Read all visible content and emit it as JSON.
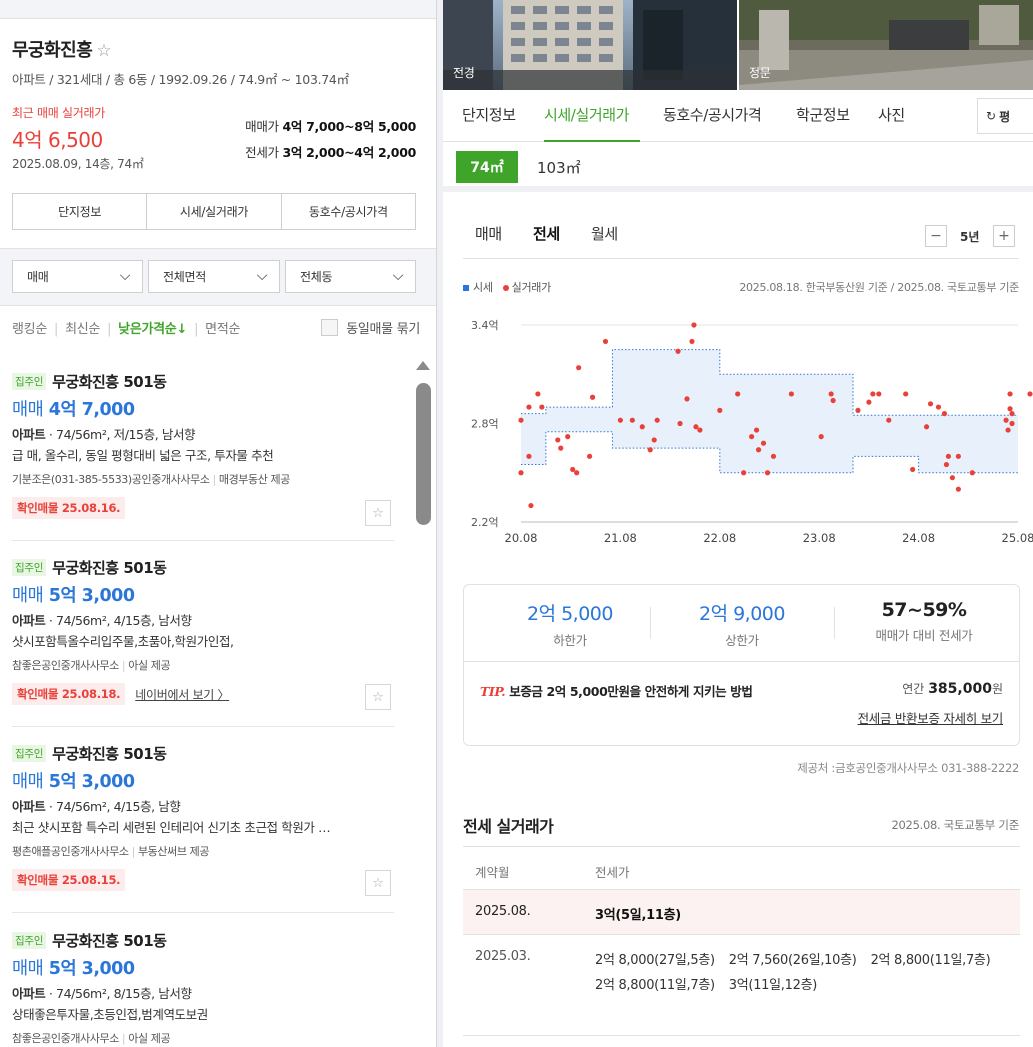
{
  "complex": {
    "name": "무궁화진흥",
    "meta": "아파트 / 321세대 / 총 6동 / 1992.09.26 / 74.9㎡ ~ 103.74㎡",
    "recent_label": "최근 매매 실거래가",
    "recent_price": "4억 6,500",
    "recent_date": "2025.08.09, 14층, 74㎡",
    "sale_label": "매매가",
    "sale_range": "4억 7,000~8억 5,000",
    "jeonse_label": "전세가",
    "jeonse_range": "3억 2,000~4억 2,000"
  },
  "left_buttons": [
    "단지정보",
    "시세/실거래가",
    "동호수/공시가격"
  ],
  "filters": {
    "deal": "매매",
    "area": "전체면적",
    "dong": "전체동"
  },
  "sort": {
    "options": [
      "랭킹순",
      "최신순",
      "낮은가격순↓",
      "면적순"
    ],
    "active_index": 2,
    "dedupe_label": "동일매물 묶기"
  },
  "listings": [
    {
      "tag": "집주인",
      "name": "무궁화진흥 501동",
      "deal": "매매",
      "price": "4억 7,000",
      "type": "아파트",
      "spec": "· 74/56m², 저/15층, 남서향",
      "note": "급 매, 올수리, 동일 평형대비 넓은 구조, 투자물 추천",
      "agency": "기분조은(031-385-5533)공인중개사사무소",
      "provider": "매경부동산 제공",
      "confirm": "확인매물 25.08.16.",
      "naver_link": ""
    },
    {
      "tag": "집주인",
      "name": "무궁화진흥 501동",
      "deal": "매매",
      "price": "5억 3,000",
      "type": "아파트",
      "spec": "· 74/56m², 4/15층, 남서향",
      "note": "샷시포함특올수리입주물,초품아,학원가인접,",
      "agency": "참좋은공인중개사사무소",
      "provider": "아실 제공",
      "confirm": "확인매물 25.08.18.",
      "naver_link": "네이버에서 보기 〉"
    },
    {
      "tag": "집주인",
      "name": "무궁화진흥 501동",
      "deal": "매매",
      "price": "5억 3,000",
      "type": "아파트",
      "spec": "· 74/56m², 4/15층, 남향",
      "note": "최근 샷시포함 특수리 세련된 인테리어 신기초 초근접 학원가 …",
      "agency": "평촌애플공인중개사사무소",
      "provider": "부동산써브 제공",
      "confirm": "확인매물 25.08.15.",
      "naver_link": ""
    },
    {
      "tag": "집주인",
      "name": "무궁화진흥 501동",
      "deal": "매매",
      "price": "5억 3,000",
      "type": "아파트",
      "spec": "· 74/56m², 8/15층, 남서향",
      "note": "상태좋은투자물,초등인접,범계역도보권",
      "agency": "참좋은공인중개사사무소",
      "provider": "아실 제공",
      "confirm": "",
      "naver_link": ""
    }
  ],
  "photos": [
    {
      "label": "전경"
    },
    {
      "label": "정문"
    }
  ],
  "tabs": [
    "단지정보",
    "시세/실거래가",
    "동호수/공시가격",
    "학군정보",
    "사진"
  ],
  "active_tab": 1,
  "pyeong_label": "평",
  "areas": [
    "74㎡",
    "103㎡"
  ],
  "deal_tabs": [
    "매매",
    "전세",
    "월세"
  ],
  "active_deal_tab": 1,
  "period": {
    "minus": "−",
    "value": "5년",
    "plus": "+"
  },
  "legend": {
    "band": "시세",
    "points": "실거래가"
  },
  "source_note": "2025.08.18. 한국부동산원 기준 / 2025.08. 국토교통부 기준",
  "chart_data": {
    "type": "scatter",
    "title": "",
    "xlabel": "",
    "ylabel": "",
    "x_ticks": [
      "20.08",
      "21.08",
      "22.08",
      "23.08",
      "24.08",
      "25.08"
    ],
    "y_ticks": [
      "2.2억",
      "2.8억",
      "3.4억"
    ],
    "xlim": [
      2020.58,
      2025.58
    ],
    "ylim": [
      2.2,
      3.4
    ],
    "grid": true,
    "legend_position": "top-left",
    "colors": {
      "band": "#2b77d9",
      "points": "#e9413a"
    },
    "series": [
      {
        "name": "시세",
        "kind": "band",
        "points": [
          {
            "x": 2020.58,
            "low": 2.55,
            "high": 2.86
          },
          {
            "x": 2020.83,
            "low": 2.55,
            "high": 2.86
          },
          {
            "x": 2020.83,
            "low": 2.75,
            "high": 2.9
          },
          {
            "x": 2021.5,
            "low": 2.75,
            "high": 2.9
          },
          {
            "x": 2021.5,
            "low": 2.65,
            "high": 3.25
          },
          {
            "x": 2022.58,
            "low": 2.65,
            "high": 3.25
          },
          {
            "x": 2022.58,
            "low": 2.5,
            "high": 3.1
          },
          {
            "x": 2023.92,
            "low": 2.5,
            "high": 3.1
          },
          {
            "x": 2023.92,
            "low": 2.6,
            "high": 2.85
          },
          {
            "x": 2024.58,
            "low": 2.6,
            "high": 2.85
          },
          {
            "x": 2024.58,
            "low": 2.5,
            "high": 2.85
          },
          {
            "x": 2025.58,
            "low": 2.5,
            "high": 2.85
          }
        ]
      },
      {
        "name": "실거래가",
        "kind": "points",
        "points": [
          [
            2020.58,
            2.82
          ],
          [
            2020.58,
            2.5
          ],
          [
            2020.66,
            2.9
          ],
          [
            2020.66,
            2.6
          ],
          [
            2020.68,
            2.3
          ],
          [
            2020.75,
            2.98
          ],
          [
            2020.79,
            2.9
          ],
          [
            2020.95,
            2.7
          ],
          [
            2020.98,
            2.65
          ],
          [
            2021.05,
            2.72
          ],
          [
            2021.1,
            2.52
          ],
          [
            2021.14,
            2.5
          ],
          [
            2021.16,
            3.14
          ],
          [
            2021.27,
            2.6
          ],
          [
            2021.3,
            2.96
          ],
          [
            2021.43,
            3.3
          ],
          [
            2021.58,
            2.82
          ],
          [
            2021.7,
            2.82
          ],
          [
            2021.8,
            2.78
          ],
          [
            2021.88,
            2.64
          ],
          [
            2021.92,
            2.7
          ],
          [
            2021.95,
            2.82
          ],
          [
            2022.16,
            3.24
          ],
          [
            2022.18,
            2.8
          ],
          [
            2022.25,
            2.95
          ],
          [
            2022.3,
            3.3
          ],
          [
            2022.32,
            3.4
          ],
          [
            2022.34,
            2.78
          ],
          [
            2022.38,
            2.76
          ],
          [
            2022.58,
            2.88
          ],
          [
            2022.76,
            2.98
          ],
          [
            2022.82,
            2.5
          ],
          [
            2022.9,
            2.72
          ],
          [
            2022.95,
            2.76
          ],
          [
            2022.97,
            2.64
          ],
          [
            2023.02,
            2.68
          ],
          [
            2023.06,
            2.5
          ],
          [
            2023.12,
            2.6
          ],
          [
            2023.3,
            2.98
          ],
          [
            2023.6,
            2.72
          ],
          [
            2023.7,
            2.98
          ],
          [
            2023.72,
            2.94
          ],
          [
            2023.97,
            2.88
          ],
          [
            2024.08,
            2.93
          ],
          [
            2024.12,
            2.98
          ],
          [
            2024.18,
            2.98
          ],
          [
            2024.28,
            2.82
          ],
          [
            2024.45,
            2.98
          ],
          [
            2024.52,
            2.52
          ],
          [
            2024.66,
            2.78
          ],
          [
            2024.7,
            2.92
          ],
          [
            2024.78,
            2.9
          ],
          [
            2024.84,
            2.86
          ],
          [
            2024.86,
            2.55
          ],
          [
            2024.88,
            2.6
          ],
          [
            2024.92,
            2.47
          ],
          [
            2024.98,
            2.6
          ],
          [
            2024.98,
            2.4
          ],
          [
            2025.12,
            2.5
          ],
          [
            2025.46,
            2.82
          ],
          [
            2025.48,
            2.76
          ],
          [
            2025.5,
            2.98
          ],
          [
            2025.52,
            2.8
          ],
          [
            2025.52,
            2.86
          ],
          [
            2025.5,
            2.89
          ],
          [
            2025.96,
            2.98
          ]
        ]
      }
    ]
  },
  "summary": {
    "low_value": "2억 5,000",
    "low_label": "하한가",
    "high_value": "2억 9,000",
    "high_label": "상한가",
    "ratio_value": "57~59%",
    "ratio_label": "매매가 대비 전세가"
  },
  "tip": {
    "mark": "TIP.",
    "text": "보증금 2억 5,000만원을 안전하게 지키는 방법",
    "yearly_label": "연간",
    "yearly_value": "385,000",
    "yearly_unit": "원",
    "link": "전세금 반환보증 자세히 보기"
  },
  "provider_note": "제공처 :금호공인중개사사무소 031-388-2222",
  "real_trades": {
    "title": "전세 실거래가",
    "source": "2025.08. 국토교통부 기준",
    "col_month": "계약월",
    "col_price": "전세가",
    "rows": [
      {
        "month": "2025.08.",
        "values": [
          "3억(5일,11층)"
        ],
        "highlight": true
      },
      {
        "month": "2025.03.",
        "values": [
          "2억 8,000(27일,5층)",
          "2억 7,560(26일,10층)",
          "2억 8,800(11일,7층)",
          "2억 8,800(11일,7층)",
          "3억(11일,12층)"
        ],
        "highlight": false
      }
    ]
  }
}
